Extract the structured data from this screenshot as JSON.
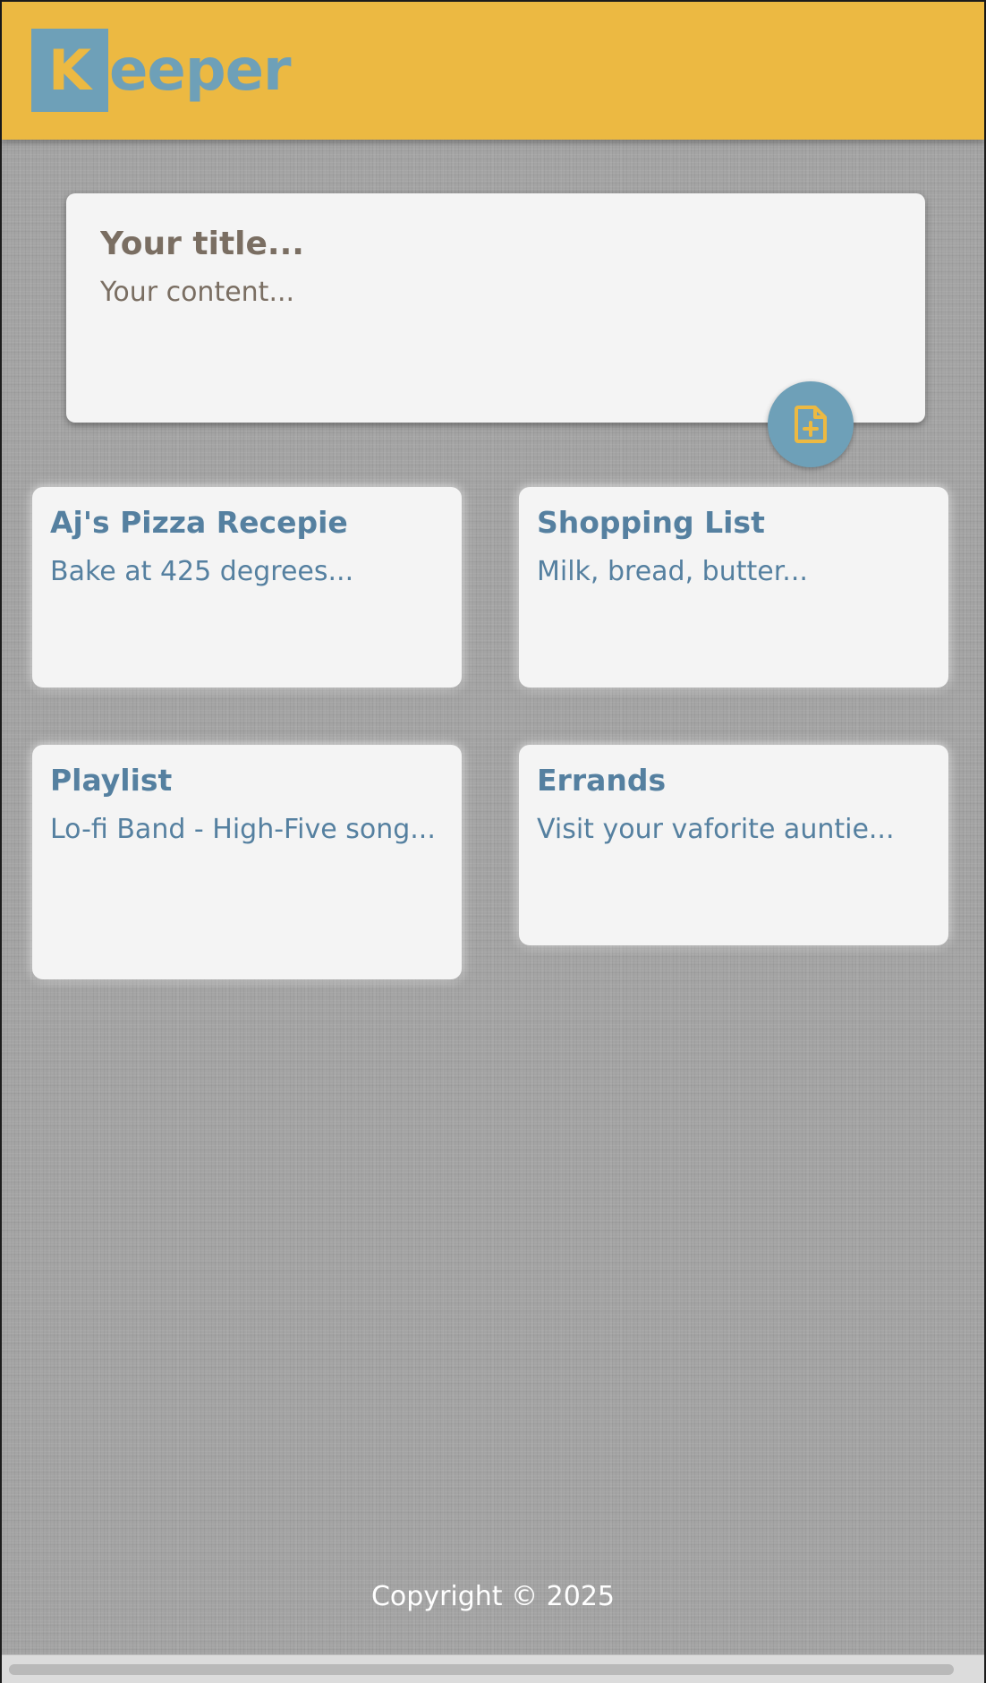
{
  "header": {
    "logo_initial": "K",
    "logo_rest": "eeper"
  },
  "create_note": {
    "title_placeholder": "Your title...",
    "content_placeholder": "Your content...",
    "add_button_icon": "note-add-icon"
  },
  "notes": [
    {
      "title": "Aj's Pizza Recepie",
      "content": "Bake at 425 degrees..."
    },
    {
      "title": "Shopping List",
      "content": "Milk, bread, butter..."
    },
    {
      "title": "Playlist",
      "content": "Lo-fi Band - High-Five song..."
    },
    {
      "title": "Errands",
      "content": "Visit your vaforite auntie..."
    }
  ],
  "footer": {
    "text": "Copyright © 2025"
  },
  "colors": {
    "header_bg": "#ecb942",
    "accent_blue": "#6ea0b8",
    "note_text": "#5580a0",
    "card_bg": "#f4f4f4",
    "placeholder_text": "#7a6e62"
  }
}
